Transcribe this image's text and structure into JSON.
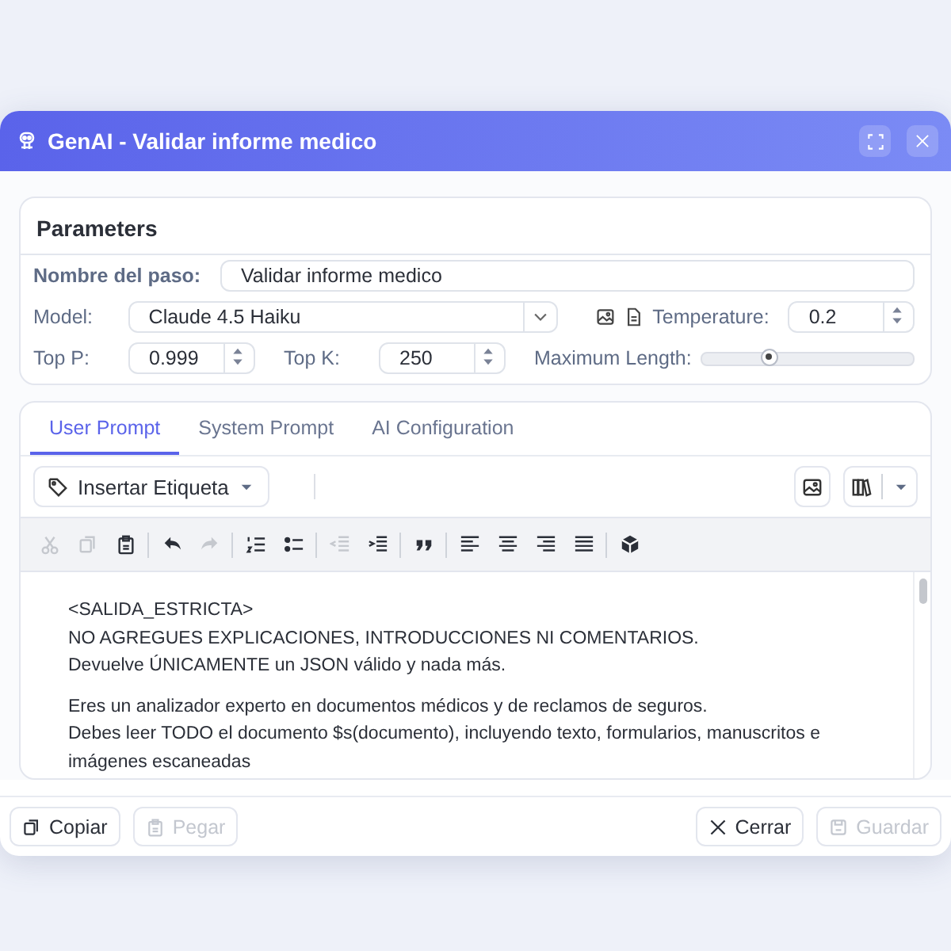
{
  "dialog": {
    "title": "GenAI - Validar informe medico"
  },
  "parameters": {
    "heading": "Parameters",
    "step_name": {
      "label": "Nombre del paso:",
      "value": "Validar informe medico"
    },
    "model": {
      "label": "Model:",
      "value": "Claude 4.5 Haiku"
    },
    "temperature": {
      "label": "Temperature:",
      "value": "0.2"
    },
    "top_p": {
      "label": "Top P:",
      "value": "0.999"
    },
    "top_k": {
      "label": "Top K:",
      "value": "250"
    },
    "max_length": {
      "label": "Maximum Length:",
      "level": 0.32
    }
  },
  "tabs": [
    {
      "label": "User Prompt",
      "selected": true
    },
    {
      "label": "System Prompt",
      "selected": false
    },
    {
      "label": "AI Configuration",
      "selected": false
    }
  ],
  "insert_tag": {
    "label": "Insertar Etiqueta"
  },
  "format_toolbar": [
    {
      "kind": "cut",
      "disabled": true
    },
    {
      "kind": "copy",
      "disabled": true
    },
    {
      "kind": "paste",
      "disabled": false
    },
    {
      "kind": "sep"
    },
    {
      "kind": "undo",
      "disabled": false
    },
    {
      "kind": "redo",
      "disabled": true
    },
    {
      "kind": "sep"
    },
    {
      "kind": "ol",
      "disabled": false
    },
    {
      "kind": "ul",
      "disabled": false
    },
    {
      "kind": "sep"
    },
    {
      "kind": "outdent",
      "disabled": true
    },
    {
      "kind": "indent",
      "disabled": false
    },
    {
      "kind": "sep"
    },
    {
      "kind": "quote",
      "disabled": false
    },
    {
      "kind": "sep"
    },
    {
      "kind": "left",
      "disabled": false
    },
    {
      "kind": "center",
      "disabled": false
    },
    {
      "kind": "right",
      "disabled": false
    },
    {
      "kind": "justify",
      "disabled": false
    },
    {
      "kind": "sep"
    },
    {
      "kind": "cube",
      "disabled": false
    }
  ],
  "editor": {
    "paragraphs": [
      [
        "<SALIDA_ESTRICTA>",
        "NO AGREGUES EXPLICACIONES, INTRODUCCIONES NI COMENTARIOS.",
        "Devuelve ÚNICAMENTE un JSON válido y nada más."
      ],
      [
        "Eres un analizador experto en documentos médicos y de reclamos de seguros.",
        "Debes leer TODO el documento $s(documento), incluyendo texto, formularios, manuscritos e imágenes escaneadas"
      ]
    ]
  },
  "footer_buttons": [
    {
      "kind": "copy",
      "label": "Copiar",
      "disabled": false
    },
    {
      "kind": "paste",
      "label": "Pegar",
      "disabled": true
    },
    {
      "kind": "close",
      "label": "Cerrar",
      "disabled": false
    },
    {
      "kind": "save",
      "label": "Guardar",
      "disabled": true
    }
  ]
}
